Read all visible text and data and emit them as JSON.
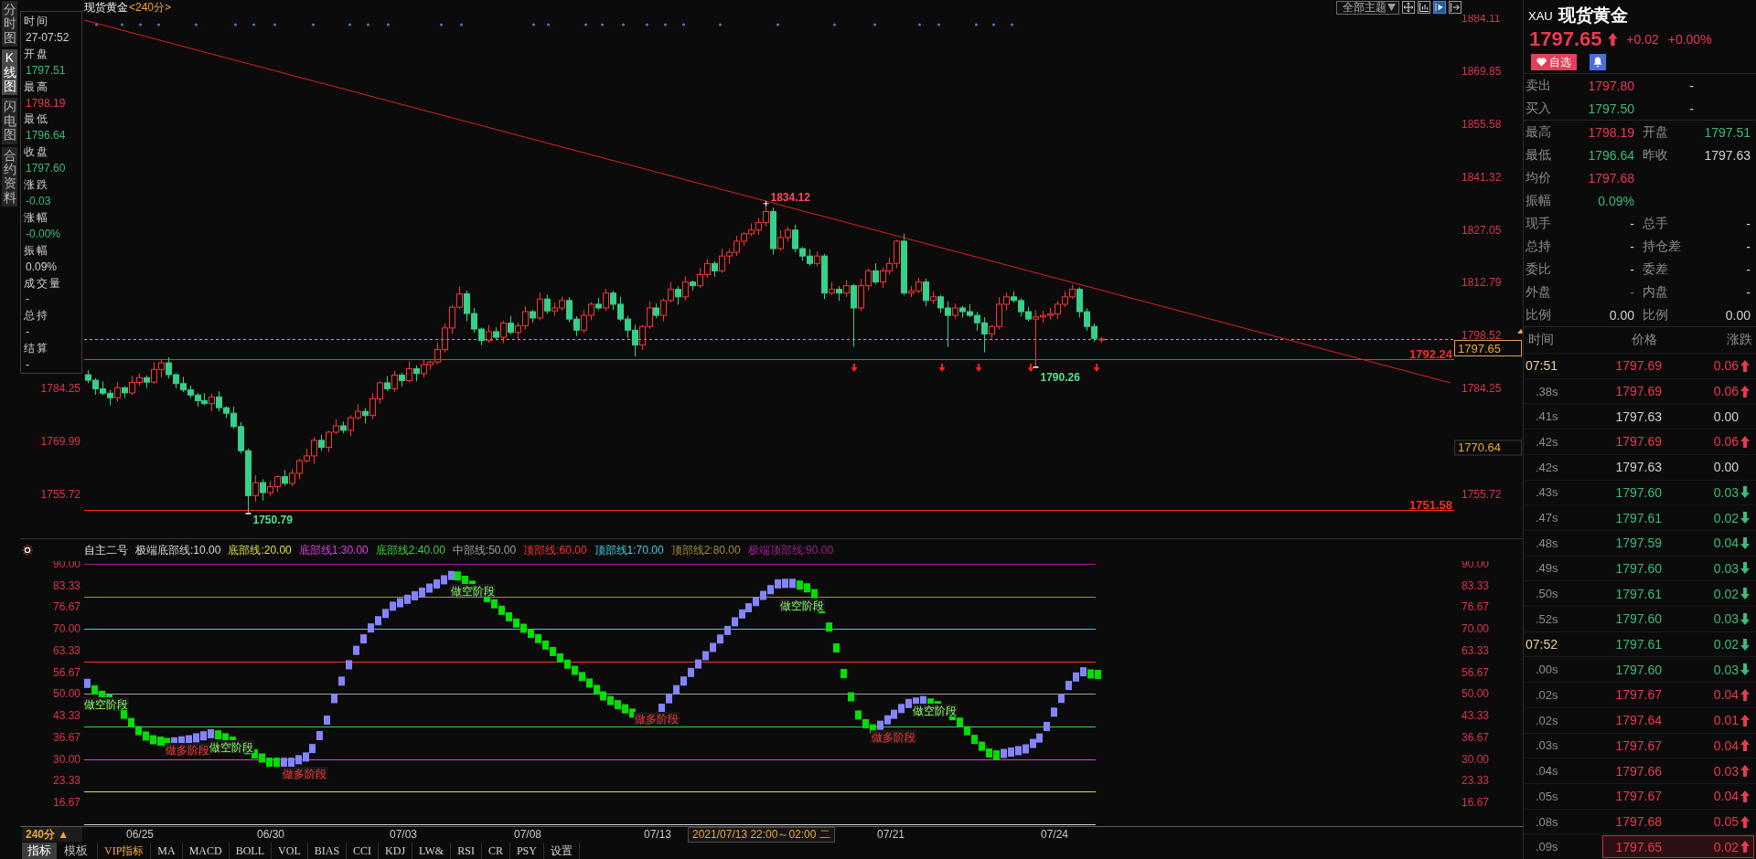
{
  "side_tabs": [
    {
      "label": "分时图",
      "selected": false
    },
    {
      "label": "K线图",
      "selected": true
    },
    {
      "label": "闪电图",
      "selected": false
    },
    {
      "label": "合约资料",
      "selected": false
    }
  ],
  "chart_header": {
    "title": "现货黄金",
    "period": "<240分>"
  },
  "toolbar": {
    "theme_button": "全部主题",
    "tools": [
      {
        "kind": "crosshair",
        "selected": false
      },
      {
        "kind": "frame",
        "selected": false
      },
      {
        "kind": "play",
        "selected": true
      },
      {
        "kind": "jump",
        "selected": false
      }
    ]
  },
  "info_panel": [
    {
      "label": "时间",
      "value": "27-07:52",
      "color": "#d2d2d2"
    },
    {
      "label": "开盘",
      "value": "1797.51",
      "color": "#3dbb78"
    },
    {
      "label": "最高",
      "value": "1798.19",
      "color": "#ea3a52"
    },
    {
      "label": "最低",
      "value": "1796.64",
      "color": "#3dbb78"
    },
    {
      "label": "收盘",
      "value": "1797.60",
      "color": "#3dbb78"
    },
    {
      "label": "涨跌",
      "value": "-0.03",
      "color": "#3dbb78"
    },
    {
      "label": "涨幅",
      "value": "-0.00%",
      "color": "#3dbb78"
    },
    {
      "label": "振幅",
      "value": "0.09%",
      "color": "#d2d2d2"
    },
    {
      "label": "成交量",
      "value": "-"
    },
    {
      "label": "总持",
      "value": "-"
    },
    {
      "label": "结算",
      "value": "-"
    }
  ],
  "main_chart": {
    "left_axis": [
      "1784.25",
      "1769.99",
      "1755.72"
    ],
    "high_label": "1834.12",
    "low_labels": [
      "1790.26",
      "1750.79"
    ],
    "cursor_price": "1770.64",
    "chart_data": {
      "type": "candlestick",
      "categories": [
        null,
        null,
        null,
        null,
        null,
        null,
        null,
        null,
        null,
        null,
        null,
        null,
        null,
        null,
        null,
        null,
        null,
        null,
        null,
        null,
        null,
        null,
        null,
        null,
        null,
        null,
        null,
        null,
        null,
        null,
        null,
        null,
        null,
        null,
        null,
        null,
        null,
        null,
        null,
        null,
        null,
        null,
        null,
        null,
        null,
        null,
        null,
        null,
        null,
        null,
        null,
        null,
        null,
        null,
        null,
        null,
        null,
        null,
        null,
        null,
        null,
        null,
        null,
        null,
        null,
        null,
        null,
        null,
        null,
        null,
        null,
        null,
        null,
        null,
        null,
        null,
        null,
        null,
        null,
        null,
        null,
        null,
        null,
        null,
        null,
        null,
        null,
        null,
        null,
        null,
        null,
        null,
        null,
        null,
        null,
        null,
        null,
        null,
        null,
        null,
        null,
        null,
        null,
        null,
        null,
        null,
        null,
        null,
        null,
        null,
        null,
        null,
        null,
        null,
        null,
        null,
        null,
        null,
        null,
        null,
        null,
        null,
        null,
        null,
        null,
        null,
        null,
        null,
        null,
        null,
        null,
        null,
        null,
        null,
        null,
        null,
        null,
        null,
        null,
        null,
        null,
        null,
        null,
        null,
        null,
        null,
        null,
        null,
        null,
        null,
        null,
        null,
        null,
        null,
        null,
        null,
        null,
        null,
        null,
        null,
        null,
        null,
        null,
        null,
        null,
        null,
        null,
        null,
        null,
        null,
        null,
        null,
        null,
        null,
        null,
        null,
        null,
        null,
        null,
        null,
        null,
        null,
        null,
        null,
        null,
        null,
        null,
        null
      ],
      "ylim": [
        1743.65,
        1884.11
      ],
      "yticks": [
        1884.11,
        1869.85,
        1855.58,
        1841.32,
        1827.05,
        1812.79,
        1798.52,
        1784.25,
        1755.72
      ],
      "ref_lines": [
        {
          "axis": "y",
          "value": 1797.65,
          "label": "1797.65",
          "color": "#e0a060"
        },
        {
          "axis": "y",
          "value": 1792.24,
          "label": "1792.24",
          "color": "#ff2a2a"
        },
        {
          "axis": "y",
          "value": 1751.58,
          "label": "1751.58",
          "color": "#ff2a2a"
        }
      ],
      "ohlc": [
        [
          1788.0,
          1789.2,
          1785.7,
          1786.5
        ],
        [
          1786.5,
          1787.1,
          1782.6,
          1784.2
        ],
        [
          1784.2,
          1786.2,
          1782.5,
          1783.0
        ],
        [
          1783.0,
          1783.9,
          1779.7,
          1781.8
        ],
        [
          1781.8,
          1786.0,
          1780.8,
          1784.5
        ],
        [
          1784.5,
          1784.9,
          1781.8,
          1783.1
        ],
        [
          1783.1,
          1787.7,
          1782.5,
          1785.9
        ],
        [
          1785.9,
          1788.4,
          1785.1,
          1787.2
        ],
        [
          1787.2,
          1787.8,
          1784.4,
          1786.0
        ],
        [
          1786.0,
          1791.4,
          1785.5,
          1789.4
        ],
        [
          1789.4,
          1792.1,
          1787.3,
          1791.2
        ],
        [
          1791.2,
          1792.7,
          1787.0,
          1788.0
        ],
        [
          1788.0,
          1788.4,
          1784.3,
          1785.6
        ],
        [
          1785.6,
          1787.4,
          1783.3,
          1783.9
        ],
        [
          1783.9,
          1785.1,
          1781.7,
          1782.5
        ],
        [
          1782.5,
          1783.1,
          1779.4,
          1781.0
        ],
        [
          1781.0,
          1783.0,
          1779.7,
          1780.2
        ],
        [
          1780.2,
          1782.9,
          1778.1,
          1782.0
        ],
        [
          1782.0,
          1783.5,
          1778.1,
          1779.1
        ],
        [
          1779.1,
          1779.5,
          1776.3,
          1777.6
        ],
        [
          1777.6,
          1779.4,
          1773.4,
          1774.0
        ],
        [
          1774.0,
          1775.2,
          1766.7,
          1767.5
        ],
        [
          1767.5,
          1768.1,
          1750.79,
          1755.4
        ],
        [
          1755.4,
          1760.9,
          1753.8,
          1758.9
        ],
        [
          1758.9,
          1759.8,
          1754.1,
          1756.2
        ],
        [
          1756.2,
          1759.3,
          1755.2,
          1757.8
        ],
        [
          1757.8,
          1760.9,
          1756.5,
          1760.5
        ],
        [
          1760.5,
          1762.3,
          1758.1,
          1758.7
        ],
        [
          1758.7,
          1762.6,
          1757.9,
          1761.4
        ],
        [
          1761.4,
          1765.4,
          1759.8,
          1764.8
        ],
        [
          1764.8,
          1768.1,
          1764.3,
          1766.1
        ],
        [
          1766.1,
          1771.2,
          1764.0,
          1770.3
        ],
        [
          1770.3,
          1771.8,
          1767.4,
          1768.4
        ],
        [
          1768.4,
          1772.9,
          1767.1,
          1772.5
        ],
        [
          1772.5,
          1776.0,
          1771.9,
          1774.2
        ],
        [
          1774.2,
          1775.4,
          1772.2,
          1773.0
        ],
        [
          1773.0,
          1777.0,
          1771.4,
          1776.4
        ],
        [
          1776.4,
          1780.1,
          1775.9,
          1778.1
        ],
        [
          1778.1,
          1779.0,
          1774.9,
          1777.0
        ],
        [
          1777.0,
          1783.0,
          1776.0,
          1781.5
        ],
        [
          1781.5,
          1786.2,
          1780.2,
          1785.8
        ],
        [
          1785.8,
          1787.6,
          1783.6,
          1784.2
        ],
        [
          1784.2,
          1789.1,
          1783.4,
          1787.9
        ],
        [
          1787.9,
          1788.5,
          1784.8,
          1786.4
        ],
        [
          1786.4,
          1791.6,
          1785.9,
          1789.6
        ],
        [
          1789.6,
          1790.5,
          1786.2,
          1788.3
        ],
        [
          1788.3,
          1792.2,
          1787.3,
          1790.7
        ],
        [
          1790.7,
          1791.8,
          1789.4,
          1791.4
        ],
        [
          1791.4,
          1796.6,
          1790.8,
          1794.8
        ],
        [
          1794.8,
          1801.8,
          1794.0,
          1800.6
        ],
        [
          1800.6,
          1806.8,
          1799.0,
          1806.2
        ],
        [
          1806.2,
          1811.8,
          1805.7,
          1809.8
        ],
        [
          1809.8,
          1810.7,
          1802.4,
          1804.5
        ],
        [
          1804.5,
          1806.0,
          1799.3,
          1800.3
        ],
        [
          1800.3,
          1800.7,
          1795.9,
          1797.2
        ],
        [
          1797.2,
          1801.4,
          1796.6,
          1799.6
        ],
        [
          1799.6,
          1800.8,
          1797.3,
          1798.1
        ],
        [
          1798.1,
          1802.5,
          1796.5,
          1801.9
        ],
        [
          1801.9,
          1803.9,
          1798.9,
          1799.4
        ],
        [
          1799.4,
          1802.1,
          1797.3,
          1801.2
        ],
        [
          1801.2,
          1806.5,
          1800.2,
          1805.0
        ],
        [
          1805.0,
          1805.4,
          1802.0,
          1803.3
        ],
        [
          1803.3,
          1810.2,
          1802.7,
          1808.4
        ],
        [
          1808.4,
          1809.6,
          1804.4,
          1805.2
        ],
        [
          1805.2,
          1807.4,
          1803.9,
          1806.0
        ],
        [
          1806.0,
          1809.1,
          1805.2,
          1808.0
        ],
        [
          1808.0,
          1808.9,
          1802.1,
          1803.0
        ],
        [
          1803.0,
          1803.8,
          1798.4,
          1800.0
        ],
        [
          1800.0,
          1805.5,
          1799.2,
          1804.0
        ],
        [
          1804.0,
          1807.6,
          1802.7,
          1807.0
        ],
        [
          1807.0,
          1808.8,
          1805.5,
          1806.0
        ],
        [
          1806.0,
          1811.2,
          1805.2,
          1810.0
        ],
        [
          1810.0,
          1810.6,
          1805.4,
          1807.0
        ],
        [
          1807.0,
          1809.0,
          1802.5,
          1803.0
        ],
        [
          1803.0,
          1803.9,
          1797.9,
          1800.0
        ],
        [
          1800.0,
          1801.5,
          1792.9,
          1796.0
        ],
        [
          1796.0,
          1801.4,
          1794.7,
          1801.0
        ],
        [
          1801.0,
          1807.8,
          1800.4,
          1806.0
        ],
        [
          1806.0,
          1807.2,
          1803.2,
          1804.0
        ],
        [
          1804.0,
          1808.6,
          1802.4,
          1808.0
        ],
        [
          1808.0,
          1813.0,
          1807.5,
          1811.0
        ],
        [
          1811.0,
          1811.9,
          1806.9,
          1809.0
        ],
        [
          1809.0,
          1814.5,
          1808.0,
          1813.0
        ],
        [
          1813.0,
          1813.4,
          1810.7,
          1812.0
        ],
        [
          1812.0,
          1816.8,
          1811.4,
          1815.0
        ],
        [
          1815.0,
          1819.2,
          1814.2,
          1818.0
        ],
        [
          1818.0,
          1818.6,
          1814.4,
          1816.0
        ],
        [
          1816.0,
          1822.0,
          1815.5,
          1820.0
        ],
        [
          1820.0,
          1821.9,
          1817.9,
          1821.0
        ],
        [
          1821.0,
          1825.5,
          1820.0,
          1824.0
        ],
        [
          1824.0,
          1826.4,
          1822.7,
          1826.0
        ],
        [
          1826.0,
          1828.8,
          1825.4,
          1827.0
        ],
        [
          1827.0,
          1830.2,
          1825.7,
          1829.0
        ],
        [
          1829.0,
          1834.12,
          1827.9,
          1832.0
        ],
        [
          1832.0,
          1833.0,
          1820.4,
          1822.0
        ],
        [
          1822.0,
          1827.0,
          1821.5,
          1825.0
        ],
        [
          1825.0,
          1827.9,
          1823.9,
          1827.0
        ],
        [
          1827.0,
          1828.5,
          1821.0,
          1822.0
        ],
        [
          1822.0,
          1822.4,
          1818.7,
          1820.0
        ],
        [
          1820.0,
          1821.8,
          1817.4,
          1818.0
        ],
        [
          1818.0,
          1821.2,
          1817.2,
          1820.0
        ],
        [
          1820.0,
          1820.6,
          1808.4,
          1810.0
        ],
        [
          1810.0,
          1813.0,
          1809.5,
          1811.0
        ],
        [
          1811.0,
          1811.9,
          1807.9,
          1810.0
        ],
        [
          1810.0,
          1813.5,
          1809.0,
          1812.0
        ],
        [
          1812.0,
          1812.4,
          1795.5,
          1806.0
        ],
        [
          1806.0,
          1813.8,
          1805.2,
          1812.0
        ],
        [
          1812.0,
          1816.6,
          1810.7,
          1816.0
        ],
        [
          1816.0,
          1818.0,
          1812.4,
          1813.0
        ],
        [
          1813.0,
          1816.9,
          1811.4,
          1816.0
        ],
        [
          1816.0,
          1819.5,
          1815.0,
          1818.0
        ],
        [
          1818.0,
          1824.4,
          1816.7,
          1824.0
        ],
        [
          1824.0,
          1826.0,
          1809.4,
          1810.0
        ],
        [
          1810.0,
          1811.9,
          1808.9,
          1810.6
        ],
        [
          1810.6,
          1814.2,
          1810.0,
          1813.0
        ],
        [
          1813.0,
          1813.9,
          1806.4,
          1808.0
        ],
        [
          1808.0,
          1810.5,
          1807.0,
          1809.0
        ],
        [
          1809.0,
          1809.4,
          1804.7,
          1806.0
        ],
        [
          1806.0,
          1807.8,
          1795.5,
          1804.0
        ],
        [
          1804.0,
          1807.2,
          1803.2,
          1806.0
        ],
        [
          1806.0,
          1806.6,
          1803.4,
          1805.0
        ],
        [
          1805.0,
          1807.0,
          1803.5,
          1804.0
        ],
        [
          1804.0,
          1804.9,
          1799.9,
          1802.0
        ],
        [
          1802.0,
          1803.5,
          1794.0,
          1799.0
        ],
        [
          1799.0,
          1801.4,
          1797.7,
          1801.0
        ],
        [
          1801.0,
          1808.8,
          1800.2,
          1807.0
        ],
        [
          1807.0,
          1810.2,
          1805.4,
          1809.0
        ],
        [
          1809.0,
          1810.5,
          1807.5,
          1808.0
        ],
        [
          1808.0,
          1808.6,
          1803.7,
          1805.0
        ],
        [
          1805.0,
          1806.2,
          1802.4,
          1803.0
        ],
        [
          1803.0,
          1805.4,
          1790.26,
          1803.6
        ],
        [
          1803.6,
          1805.2,
          1802.0,
          1804.0
        ],
        [
          1804.0,
          1806.0,
          1802.9,
          1804.4
        ],
        [
          1804.4,
          1807.9,
          1803.1,
          1807.0
        ],
        [
          1807.0,
          1810.5,
          1806.2,
          1809.0
        ],
        [
          1809.0,
          1812.3,
          1808.4,
          1811.0
        ],
        [
          1811.0,
          1811.6,
          1803.4,
          1805.0
        ],
        [
          1805.0,
          1805.9,
          1799.9,
          1801.0
        ],
        [
          1801.0,
          1801.8,
          1796.9,
          1797.8
        ],
        [
          1797.51,
          1798.19,
          1796.64,
          1797.6
        ],
        null,
        null,
        null,
        null,
        null,
        null,
        null,
        null,
        null,
        null,
        null,
        null,
        null,
        null,
        null,
        null,
        null,
        null,
        null,
        null,
        null,
        null,
        null,
        null,
        null,
        null,
        null,
        null,
        null,
        null,
        null,
        null,
        null,
        null,
        null,
        null,
        null,
        null,
        null,
        null,
        null,
        null,
        null,
        null,
        null,
        null,
        null,
        null
      ]
    }
  },
  "indicator": {
    "title": "自主二号",
    "levels": [
      {
        "label": "极端底部线:10.00",
        "color": "#d8d8d8"
      },
      {
        "label": "底部线:20.00",
        "color": "#e0e040"
      },
      {
        "label": "底部线1:30.00",
        "color": "#e040e0"
      },
      {
        "label": "底部线2:40.00",
        "color": "#40d040"
      },
      {
        "label": "中部线:50.00",
        "color": "#a0a0a0"
      },
      {
        "label": "顶部线:60.00",
        "color": "#ff3030"
      },
      {
        "label": "顶部线1:70.00",
        "color": "#40d0e0"
      },
      {
        "label": "顶部线2:80.00",
        "color": "#a09040"
      },
      {
        "label": "极端顶部线:90.00",
        "color": "#a02090"
      }
    ],
    "left_axis": [
      "90.00",
      "83.33",
      "76.67",
      "70.00",
      "63.33",
      "56.67",
      "50.00",
      "43.33",
      "36.67",
      "30.00",
      "23.33",
      "16.67"
    ],
    "right_axis": [
      "90.00",
      "83.33",
      "76.67",
      "70.00",
      "63.33",
      "56.67",
      "50.00",
      "43.33",
      "36.67",
      "30.00",
      "23.33",
      "16.67"
    ],
    "phase_labels": [
      {
        "text": "做空阶段",
        "kind": "short"
      },
      {
        "text": "做多阶段",
        "kind": "long"
      },
      {
        "text": "做空阶段",
        "kind": "short"
      },
      {
        "text": "做多阶段",
        "kind": "long"
      },
      {
        "text": "做空阶段",
        "kind": "short"
      },
      {
        "text": "做多阶段",
        "kind": "long"
      },
      {
        "text": "做空阶段",
        "kind": "short"
      },
      {
        "text": "做多阶段",
        "kind": "long"
      },
      {
        "text": "做空阶段",
        "kind": "short"
      }
    ]
  },
  "time_axis": {
    "period_button": "240分 ▲",
    "dates": [
      "06/25",
      "06/30",
      "07/03",
      "07/08",
      "07/13",
      "07/21",
      "07/24"
    ],
    "cursor_time": "2021/07/13 22:00～02:00 二"
  },
  "bottom_tabs": {
    "views": [
      {
        "label": "指标",
        "selected": true
      },
      {
        "label": "模板",
        "selected": false
      }
    ],
    "indicators": [
      {
        "label": "VIP指标",
        "selected": true
      },
      {
        "label": "MA",
        "selected": false
      },
      {
        "label": "MACD",
        "selected": false
      },
      {
        "label": "BOLL",
        "selected": false
      },
      {
        "label": "VOL",
        "selected": false
      },
      {
        "label": "BIAS",
        "selected": false
      },
      {
        "label": "CCI",
        "selected": false
      },
      {
        "label": "KDJ",
        "selected": false
      },
      {
        "label": "LW&",
        "selected": false
      },
      {
        "label": "RSI",
        "selected": false
      },
      {
        "label": "CR",
        "selected": false
      },
      {
        "label": "PSY",
        "selected": false
      },
      {
        "label": "设置",
        "selected": false
      }
    ]
  },
  "quote": {
    "symbol": "XAU",
    "name": "现货黄金",
    "price": "1797.65",
    "kind": "up",
    "change": "+0.02",
    "change_pct": "+0.00%",
    "favorite_button": "自选",
    "order_book": [
      {
        "label": "卖出",
        "price": "1797.80",
        "color": "#ea3a52",
        "volume": "-"
      },
      {
        "label": "买入",
        "price": "1797.50",
        "color": "#3dbb78",
        "volume": "-"
      }
    ],
    "stats": [
      {
        "cells": [
          {
            "label": "最高",
            "value": "1798.19",
            "color": "#ea3a52"
          },
          {
            "label": "开盘",
            "value": "1797.51",
            "color": "#3dbb78"
          }
        ]
      },
      {
        "cells": [
          {
            "label": "最低",
            "value": "1796.64",
            "color": "#3dbb78"
          },
          {
            "label": "昨收",
            "value": "1797.63",
            "color": "#d2d2d2"
          }
        ]
      },
      {
        "cells": [
          {
            "label": "均价",
            "value": "1797.68",
            "color": "#ea3a52"
          }
        ]
      },
      {
        "cells": [
          {
            "label": "振幅",
            "value": "0.09%",
            "color": "#3dbb78"
          }
        ]
      },
      {
        "cells": [
          {
            "label": "现手",
            "value": "-",
            "color": "#d2d2d2"
          },
          {
            "label": "总手",
            "value": "-",
            "color": "#d2d2d2"
          }
        ]
      },
      {
        "cells": [
          {
            "label": "总持",
            "value": "-",
            "color": "#d2d2d2"
          },
          {
            "label": "持仓差",
            "value": "-",
            "color": "#d2d2d2"
          }
        ]
      },
      {
        "cells": [
          {
            "label": "委比",
            "value": "-",
            "color": "#d2d2d2"
          },
          {
            "label": "委差",
            "value": "-",
            "color": "#d2d2d2"
          }
        ]
      },
      {
        "cells": [
          {
            "label": "外盘",
            "value": "-",
            "color": "#ea3a52"
          },
          {
            "label": "内盘",
            "value": "-",
            "color": "#d2d2d2"
          }
        ]
      },
      {
        "cells": [
          {
            "label": "比例",
            "value": "0.00",
            "color": "#d2d2d2"
          },
          {
            "label": "比例",
            "value": "0.00",
            "color": "#d2d2d2"
          }
        ]
      }
    ]
  },
  "ticks": {
    "columns": [
      "时间",
      "价格",
      "涨跌"
    ],
    "rows": [
      {
        "time": {
          "text": "07:51",
          "kind": "minute"
        },
        "price": "1797.69",
        "change": "0.06",
        "kind": "up",
        "selected": false
      },
      {
        "time": {
          "text": ".38s",
          "kind": "second"
        },
        "price": "1797.69",
        "change": "0.06",
        "kind": "up",
        "selected": false
      },
      {
        "time": {
          "text": ".41s",
          "kind": "second"
        },
        "price": "1797.63",
        "change": "0.00",
        "kind": "flat",
        "selected": false
      },
      {
        "time": {
          "text": ".42s",
          "kind": "second"
        },
        "price": "1797.69",
        "change": "0.06",
        "kind": "up",
        "selected": false
      },
      {
        "time": {
          "text": ".42s",
          "kind": "second"
        },
        "price": "1797.63",
        "change": "0.00",
        "kind": "flat",
        "selected": false
      },
      {
        "time": {
          "text": ".43s",
          "kind": "second"
        },
        "price": "1797.60",
        "change": "0.03",
        "kind": "down",
        "selected": false
      },
      {
        "time": {
          "text": ".47s",
          "kind": "second"
        },
        "price": "1797.61",
        "change": "0.02",
        "kind": "down",
        "selected": false
      },
      {
        "time": {
          "text": ".48s",
          "kind": "second"
        },
        "price": "1797.59",
        "change": "0.04",
        "kind": "down",
        "selected": false
      },
      {
        "time": {
          "text": ".49s",
          "kind": "second"
        },
        "price": "1797.60",
        "change": "0.03",
        "kind": "down",
        "selected": false
      },
      {
        "time": {
          "text": ".50s",
          "kind": "second"
        },
        "price": "1797.61",
        "change": "0.02",
        "kind": "down",
        "selected": false
      },
      {
        "time": {
          "text": ".52s",
          "kind": "second"
        },
        "price": "1797.60",
        "change": "0.03",
        "kind": "down",
        "selected": false
      },
      {
        "time": {
          "text": "07:52",
          "kind": "minute"
        },
        "price": "1797.61",
        "change": "0.02",
        "kind": "down",
        "selected": false
      },
      {
        "time": {
          "text": ".00s",
          "kind": "second"
        },
        "price": "1797.60",
        "change": "0.03",
        "kind": "down",
        "selected": false
      },
      {
        "time": {
          "text": ".02s",
          "kind": "second"
        },
        "price": "1797.67",
        "change": "0.04",
        "kind": "up",
        "selected": false
      },
      {
        "time": {
          "text": ".02s",
          "kind": "second"
        },
        "price": "1797.64",
        "change": "0.01",
        "kind": "up",
        "selected": false
      },
      {
        "time": {
          "text": ".03s",
          "kind": "second"
        },
        "price": "1797.67",
        "change": "0.04",
        "kind": "up",
        "selected": false
      },
      {
        "time": {
          "text": ".04s",
          "kind": "second"
        },
        "price": "1797.66",
        "change": "0.03",
        "kind": "up",
        "selected": false
      },
      {
        "time": {
          "text": ".05s",
          "kind": "second"
        },
        "price": "1797.67",
        "change": "0.04",
        "kind": "up",
        "selected": false
      },
      {
        "time": {
          "text": ".08s",
          "kind": "second"
        },
        "price": "1797.68",
        "change": "0.05",
        "kind": "up",
        "selected": false
      },
      {
        "time": {
          "text": ".09s",
          "kind": "second"
        },
        "price": "1797.65",
        "change": "0.02",
        "kind": "up",
        "selected": true
      }
    ]
  }
}
